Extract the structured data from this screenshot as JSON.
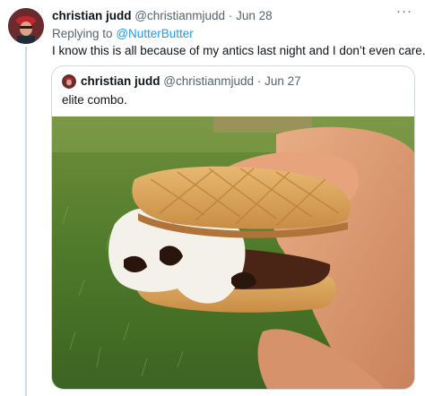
{
  "tweet": {
    "author_name": "christian judd",
    "author_handle": "@christianmjudd",
    "date": "Jun 28",
    "separator": "·",
    "more_label": "···",
    "replying_prefix": "Replying to",
    "replying_handle": "@NutterButter",
    "text": "I know this is all because of my antics last night and I don’t even care."
  },
  "quoted_tweet": {
    "author_name": "christian judd",
    "author_handle": "@christianmjudd",
    "date": "Jun 27",
    "separator": "·",
    "text": "elite combo.",
    "image_subject": "photo-smores-nutter-butter"
  },
  "colors": {
    "text_primary": "#0f1419",
    "text_secondary": "#536471",
    "link": "#1d9bf0",
    "border": "#cfd9de"
  }
}
